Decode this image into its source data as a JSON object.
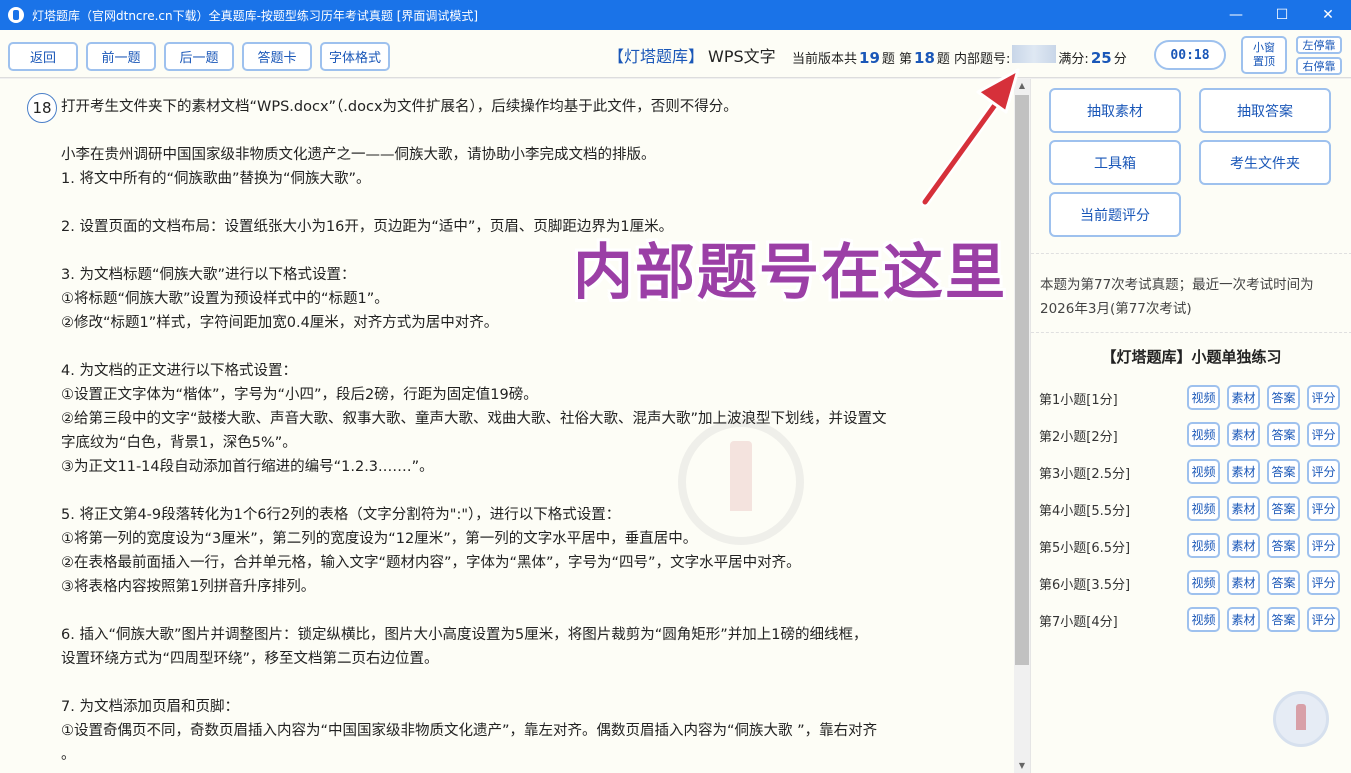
{
  "window": {
    "title": "灯塔题库（官网dtncre.cn下载）全真题库-按题型练习历年考试真题 [界面调试模式]",
    "controls": {
      "minimize": "—",
      "maximize": "☐",
      "close": "✕"
    }
  },
  "toolbar": {
    "back": "返回",
    "prev": "前一题",
    "next": "后一题",
    "answer_card": "答题卡",
    "font_format": "字体格式",
    "brand": "【灯塔题库】",
    "subject": "WPS文字",
    "total_prefix": "当前版本共",
    "total_count": "19",
    "total_unit": "题 第",
    "current": "18",
    "current_unit": "题 内部题号:",
    "score_label": "满分:",
    "score": "25",
    "score_unit": "分",
    "timer": "00:18",
    "pin_line1": "小窗",
    "pin_line2": "置顶",
    "dock_left": "左停靠",
    "dock_right": "右停靠"
  },
  "question": {
    "number": "18",
    "lines": [
      "打开考生文件夹下的素材文档“WPS.docx”（.docx为文件扩展名），后续操作均基于此文件，否则不得分。",
      "",
      "小李在贵州调研中国国家级非物质文化遗产之一——侗族大歌，请协助小李完成文档的排版。",
      "1. 将文中所有的“侗族歌曲”替换为“侗族大歌”。",
      "",
      "2. 设置页面的文档布局：设置纸张大小为16开，页边距为“适中”，页眉、页脚距边界为1厘米。",
      "",
      "3. 为文档标题“侗族大歌”进行以下格式设置：",
      "①将标题“侗族大歌”设置为预设样式中的“标题1”。",
      "②修改“标题1”样式，字符间距加宽0.4厘米，对齐方式为居中对齐。",
      "",
      "4. 为文档的正文进行以下格式设置：",
      "①设置正文字体为“楷体”，字号为“小四”，段后2磅，行距为固定值19磅。",
      "②给第三段中的文字“鼓楼大歌、声音大歌、叙事大歌、童声大歌、戏曲大歌、社俗大歌、混声大歌”加上波浪型下划线，并设置文",
      "字底纹为“白色，背景1，深色5%”。",
      "③为正文11-14段自动添加首行缩进的编号“1.2.3.……”。",
      "",
      "5. 将正文第4-9段落转化为1个6行2列的表格（文字分割符为\":\"），进行以下格式设置：",
      "①将第一列的宽度设为“3厘米”，第二列的宽度设为“12厘米”，第一列的文字水平居中，垂直居中。",
      "②在表格最前面插入一行，合并单元格，输入文字“题材内容”，字体为“黑体”，字号为“四号”，文字水平居中对齐。",
      "③将表格内容按照第1列拼音升序排列。",
      "",
      "6. 插入“侗族大歌”图片并调整图片：锁定纵横比，图片大小高度设置为5厘米，将图片裁剪为“圆角矩形”并加上1磅的细线框，",
      "设置环绕方式为“四周型环绕”，移至文档第二页右边位置。",
      "",
      "7. 为文档添加页眉和页脚：",
      "①设置奇偶页不同，奇数页眉插入内容为“中国国家级非物质文化遗产”，靠左对齐。偶数页眉插入内容为“侗族大歌 ”，靠右对齐",
      "。"
    ]
  },
  "panel": {
    "extract_material": "抽取素材",
    "extract_answer": "抽取答案",
    "toolbox": "工具箱",
    "candidate_folder": "考生文件夹",
    "grade_current": "当前题评分",
    "exam_info": "本题为第77次考试真题；最近一次考试时间为2026年3月(第77次考试)",
    "practice_title": "【灯塔题库】小题单独练习",
    "sub_buttons": {
      "video": "视频",
      "material": "素材",
      "answer": "答案",
      "grade": "评分"
    },
    "subquestions": [
      "第1小题[1分]",
      "第2小题[2分]",
      "第3小题[2.5分]",
      "第4小题[5.5分]",
      "第5小题[6.5分]",
      "第6小题[3.5分]",
      "第7小题[4分]"
    ]
  },
  "annotation": {
    "text": "内部题号在这里",
    "color": "#9b3fa6"
  },
  "colors": {
    "accent": "#1a73e8",
    "button_text": "#1a57b8",
    "button_border": "#9ec1ee",
    "content_bg": "#fdfdf6"
  }
}
